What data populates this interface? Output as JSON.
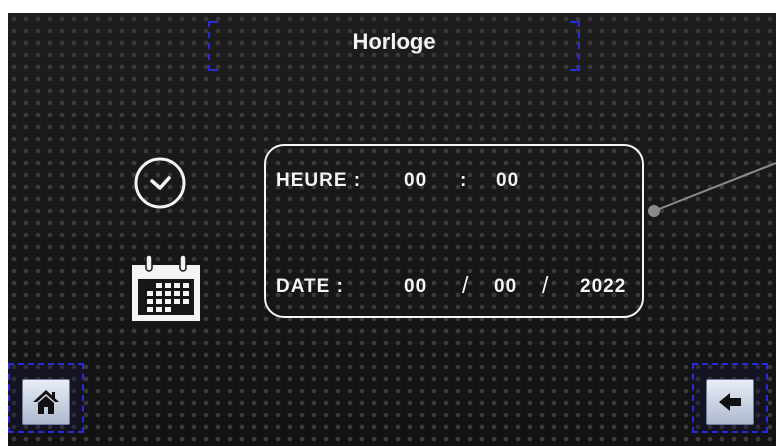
{
  "header": {
    "title": "Horloge"
  },
  "clock": {
    "label": "HEURE :",
    "hours": "00",
    "separator": ":",
    "minutes": "00"
  },
  "date": {
    "label": "DATE :",
    "day": "00",
    "sep1": "/",
    "month": "00",
    "sep2": "/",
    "year": "2022"
  },
  "icons": {
    "clock": "clock-icon",
    "calendar": "calendar-icon",
    "home": "home-icon",
    "back": "back-arrow-icon"
  },
  "colors": {
    "background": "#161616",
    "text": "#f4f4f4",
    "accent_border": "#2a2ad8",
    "button_face": "#c9d2e4",
    "button_icon": "#111111"
  }
}
